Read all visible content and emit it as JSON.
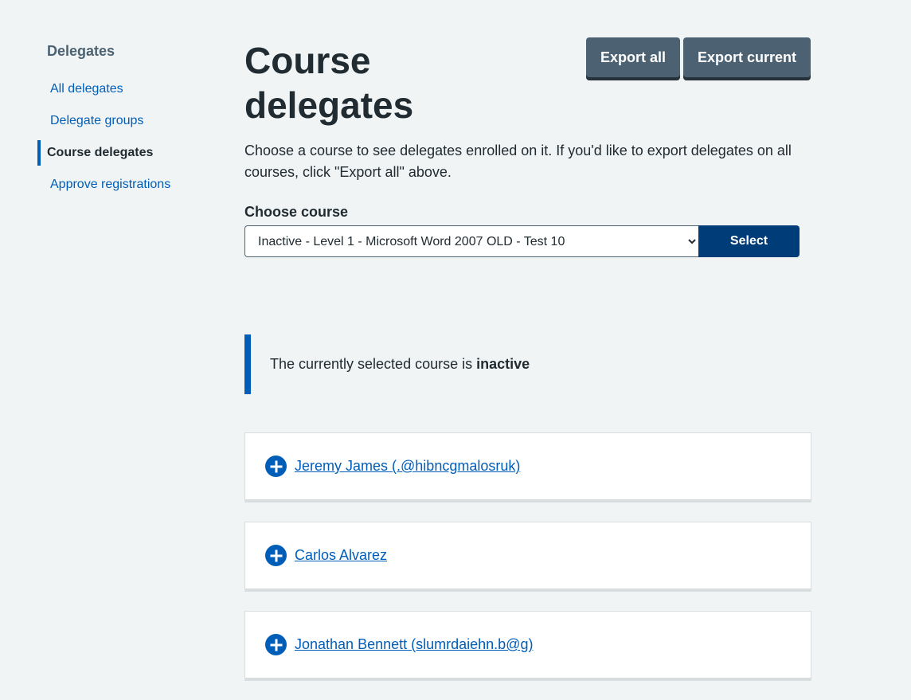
{
  "sidebar": {
    "heading": "Delegates",
    "items": [
      {
        "label": "All delegates"
      },
      {
        "label": "Delegate groups"
      },
      {
        "label": "Course delegates"
      },
      {
        "label": "Approve registrations"
      }
    ]
  },
  "header": {
    "title": "Course delegates",
    "export_all_label": "Export all",
    "export_current_label": "Export current"
  },
  "main": {
    "intro": "Choose a course to see delegates enrolled on it. If you'd like to export delegates on all courses, click \"Export all\" above.",
    "choose_course_label": "Choose course",
    "selected_course": "Inactive - Level 1 - Microsoft Word 2007 OLD - Test 10",
    "select_button_label": "Select",
    "inset_text_prefix": "The currently selected course is ",
    "inset_text_status": "inactive"
  },
  "delegates": [
    {
      "name": "Jeremy James (.@hibncgmalosruk)"
    },
    {
      "name": "Carlos Alvarez"
    },
    {
      "name": "Jonathan Bennett (slumrdaiehn.b@g)"
    }
  ],
  "colors": {
    "link": "#005eb8",
    "primary_button": "#003d78",
    "secondary_button": "#4c6272",
    "background": "#f0f4f5"
  }
}
